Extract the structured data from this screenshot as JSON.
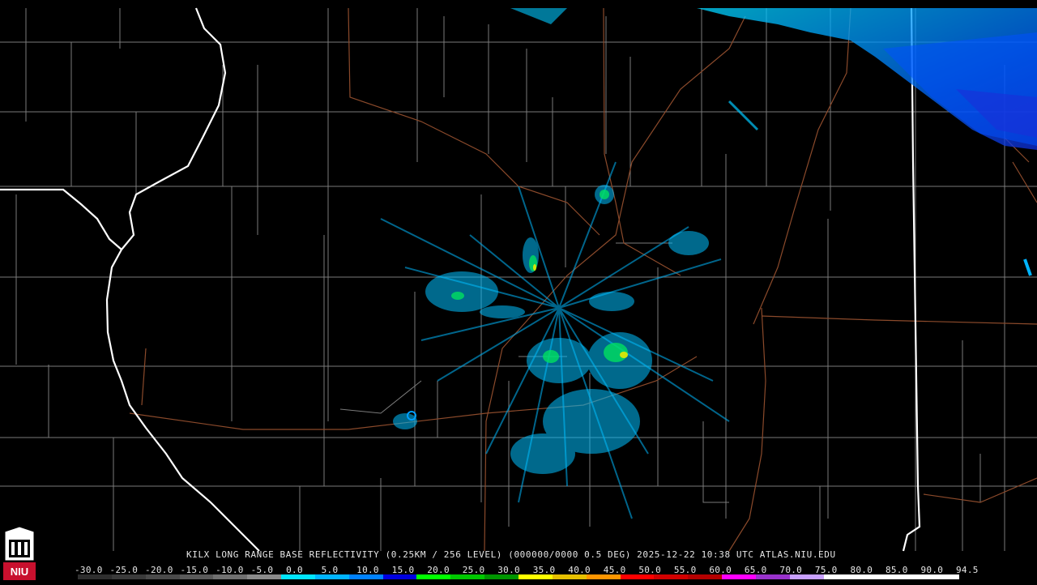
{
  "caption": "KILX LONG RANGE BASE REFLECTIVITY (0.25KM / 256 LEVEL) (000000/0000 0.5 DEG) 2025-12-22 10:38 UTC  ATLAS.NIU.EDU",
  "legend": {
    "labels": [
      "-30.0",
      "-25.0",
      "-20.0",
      "-15.0",
      "-10.0",
      "-5.0",
      "0.0",
      "5.0",
      "10.0",
      "15.0",
      "20.0",
      "25.0",
      "30.0",
      "35.0",
      "40.0",
      "45.0",
      "50.0",
      "55.0",
      "60.0",
      "65.0",
      "70.0",
      "75.0",
      "80.0",
      "85.0",
      "90.0",
      "94.5"
    ],
    "colors": [
      "#2e2e2e",
      "#3a3a3a",
      "#4a4a4a",
      "#5a5a5a",
      "#707070",
      "#8a8a8a",
      "#00e5ff",
      "#00b4ff",
      "#0082ff",
      "#0000e0",
      "#00ff00",
      "#00c800",
      "#009600",
      "#ffff00",
      "#e6c000",
      "#ff9600",
      "#ff0000",
      "#d20000",
      "#b40000",
      "#ff00ff",
      "#9932cc",
      "#c8a0ff",
      "#ffffff",
      "#ffffff",
      "#ffffff",
      "#ffffff"
    ]
  },
  "logo": {
    "text": "NIU",
    "color": "#c8102e"
  },
  "map_colors": {
    "background": "#000000",
    "state_border": "#ffffff",
    "county_lines": "#7a7a7a",
    "highways": "#8b4a2b"
  }
}
